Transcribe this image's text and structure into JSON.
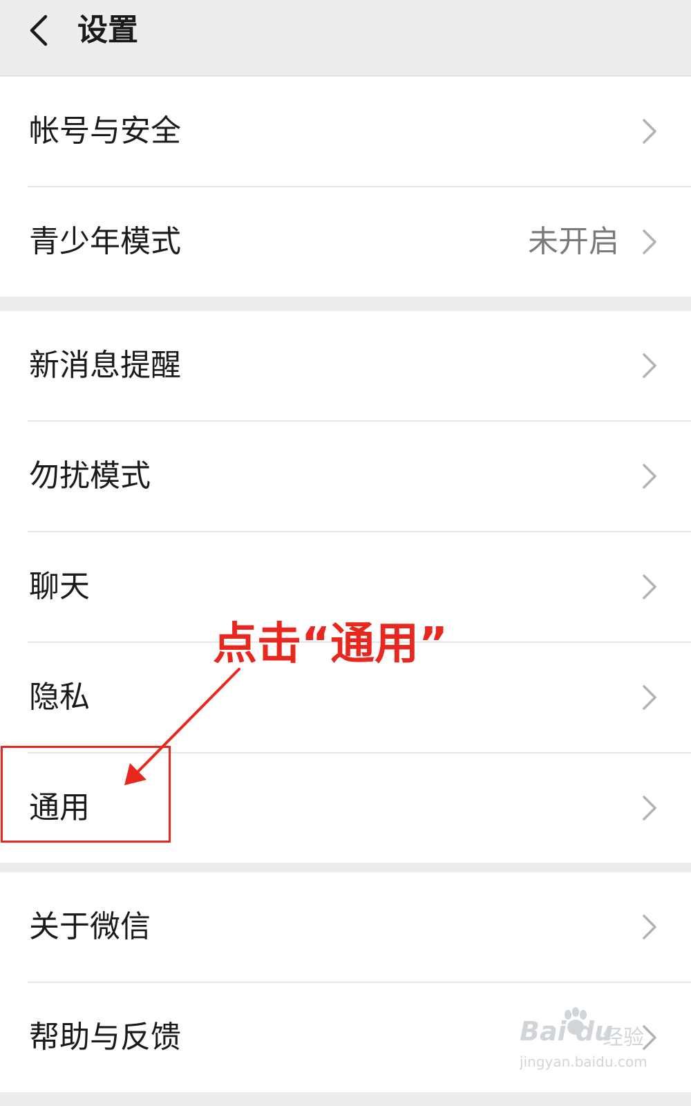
{
  "header": {
    "title": "设置",
    "back_icon": "chevron-left-icon"
  },
  "groups": [
    {
      "items": [
        {
          "label": "帐号与安全",
          "value": ""
        },
        {
          "label": "青少年模式",
          "value": "未开启"
        }
      ]
    },
    {
      "items": [
        {
          "label": "新消息提醒",
          "value": ""
        },
        {
          "label": "勿扰模式",
          "value": ""
        },
        {
          "label": "聊天",
          "value": ""
        },
        {
          "label": "隐私",
          "value": ""
        },
        {
          "label": "通用",
          "value": ""
        }
      ]
    },
    {
      "items": [
        {
          "label": "关于微信",
          "value": ""
        },
        {
          "label": "帮助与反馈",
          "value": ""
        }
      ]
    }
  ],
  "annotation": {
    "text": "点击“通用”",
    "color": "#e8281e",
    "target": "通用"
  },
  "watermark": {
    "brand": "Bai du",
    "sub": "经验",
    "url": "jingyan.baidu.com"
  },
  "colors": {
    "background": "#ededed",
    "row": "#ffffff",
    "secondary_text": "#7a7a7a",
    "chevron": "#b2b2b2"
  }
}
